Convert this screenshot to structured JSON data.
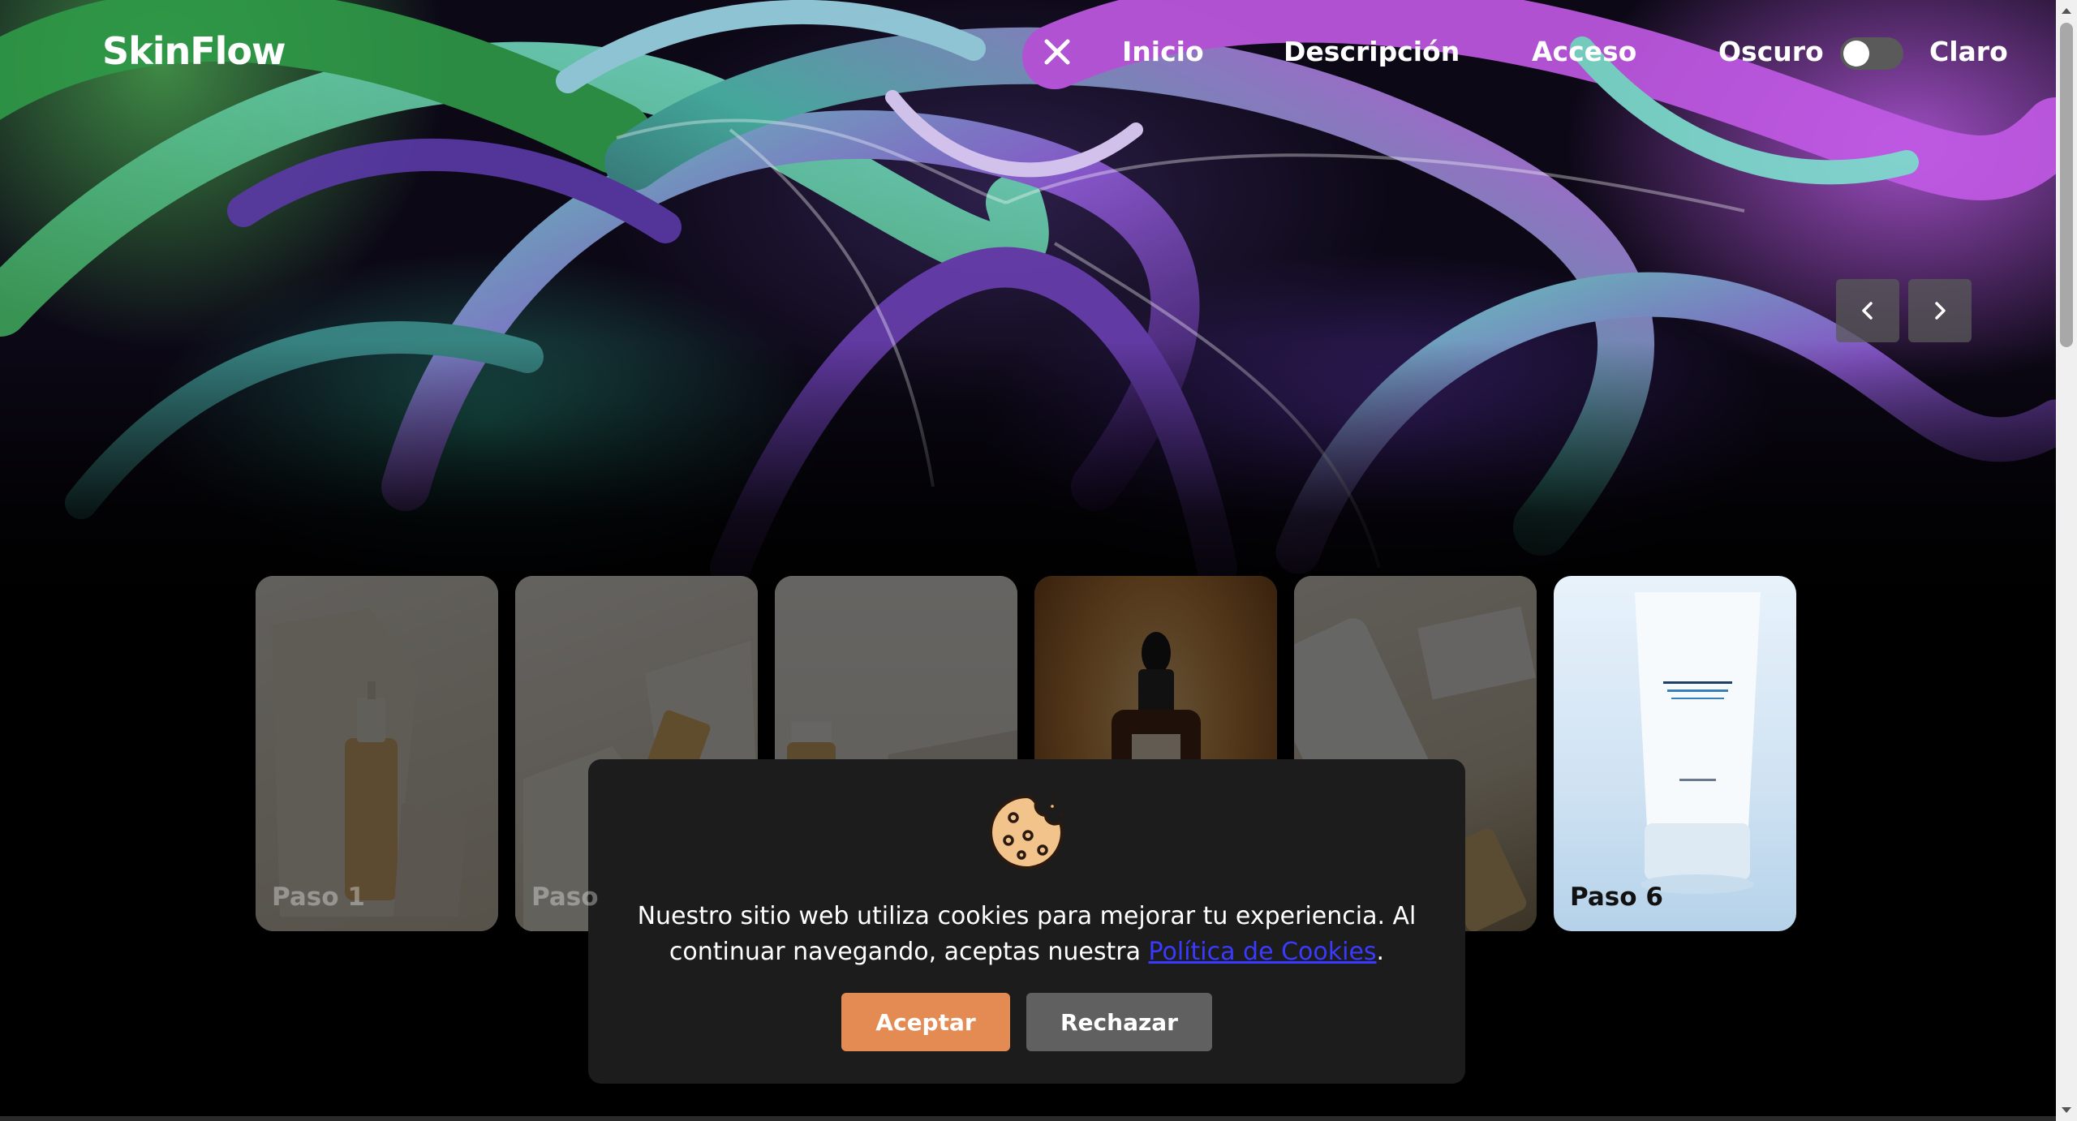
{
  "brand": "SkinFlow",
  "nav": {
    "links": [
      "Inicio",
      "Descripción",
      "Acceso"
    ],
    "theme_left": "Oscuro",
    "theme_right": "Claro"
  },
  "cards": [
    {
      "label": "Paso 1"
    },
    {
      "label": "Paso"
    },
    {
      "label": ""
    },
    {
      "label": ""
    },
    {
      "label": ""
    },
    {
      "label": "Paso 6"
    }
  ],
  "cookie": {
    "text_before": "Nuestro sitio web utiliza cookies para mejorar tu experiencia. Al continuar navegando, aceptas nuestra ",
    "link": "Política de Cookies",
    "text_after": ".",
    "accept": "Aceptar",
    "reject": "Rechazar"
  },
  "colors": {
    "accept_button": "#e38b52",
    "reject_button": "#606060",
    "modal_bg": "#1c1c1c",
    "link": "#3a3aff"
  },
  "icons": [
    "close-icon",
    "chevron-left-icon",
    "chevron-right-icon",
    "cookie-icon",
    "scroll-up-icon",
    "scroll-down-icon"
  ]
}
